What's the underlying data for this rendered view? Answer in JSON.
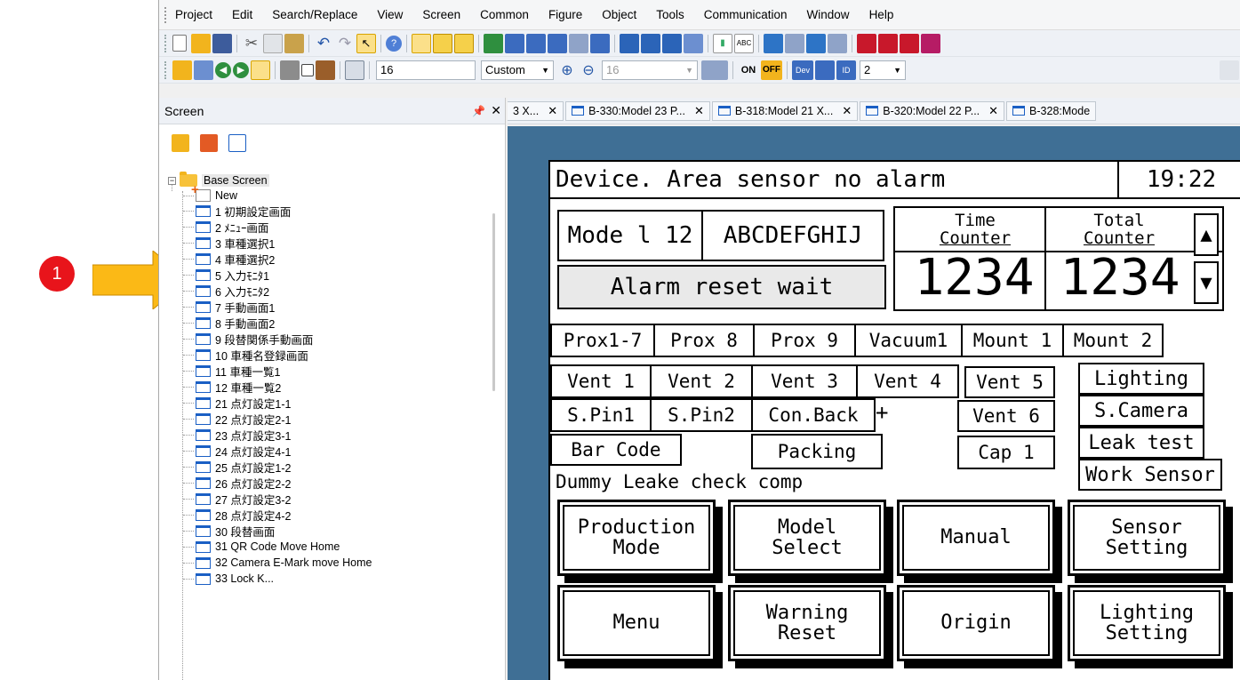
{
  "annotation": {
    "badge": "1"
  },
  "menubar": {
    "items": [
      "Project",
      "Edit",
      "Search/Replace",
      "View",
      "Screen",
      "Common",
      "Figure",
      "Object",
      "Tools",
      "Communication",
      "Window",
      "Help"
    ]
  },
  "toolbar3": {
    "font_size": "16",
    "custom": "Custom",
    "zoom": "16",
    "on": "ON",
    "off": "OFF",
    "dev": "Dev",
    "id": "ID",
    "layer": "2"
  },
  "screen_panel": {
    "title": "Screen",
    "pin": "⬜",
    "close": "✕",
    "root": "Base Screen",
    "new_item": "New",
    "items": [
      "1 初期設定画面",
      "2 ﾒﾆｭｰ画面",
      "3 車種選択1",
      "4 車種選択2",
      "5 入力ﾓﾆﾀ1",
      "6 入力ﾓﾆﾀ2",
      "7 手動画面1",
      "8 手動画面2",
      "9 段替関係手動画面",
      "10 車種名登録画面",
      "11 車種一覧1",
      "12 車種一覧2",
      "21 点灯設定1-1",
      "22 点灯設定2-1",
      "23 点灯設定3-1",
      "24 点灯設定4-1",
      "25 点灯設定1-2",
      "26 点灯設定2-2",
      "27 点灯設定3-2",
      "28 点灯設定4-2",
      "30 段替画面",
      "31 QR Code Move Home",
      "32 Camera E-Mark move Home",
      "33 Lock K..."
    ]
  },
  "tabs": [
    {
      "label": "3 X..."
    },
    {
      "label": "B-330:Model 23 P..."
    },
    {
      "label": "B-318:Model 21 X..."
    },
    {
      "label": "B-320:Model 22 P..."
    },
    {
      "label": "B-328:Mode"
    }
  ],
  "hmi": {
    "status": "Device. Area sensor no alarm",
    "time": "19:22",
    "model": "Mode l 12",
    "model_name": "ABCDEFGHIJ",
    "alarm_reset": "Alarm reset wait",
    "time_counter_label": [
      "Time",
      "Counter"
    ],
    "total_counter_label": [
      "Total",
      "Counter"
    ],
    "time_counter_value": "1234",
    "total_counter_value": "1234",
    "row1": [
      "Prox1-7",
      "Prox 8",
      "Prox 9",
      "Vacuum1",
      "Mount 1",
      "Mount 2"
    ],
    "row2": [
      "Vent 1",
      "Vent 2",
      "Vent 3",
      "Vent 4",
      "Vent 5",
      "Lighting"
    ],
    "row3": [
      "S.Pin1",
      "S.Pin2",
      "Con.Back",
      "Vent 6",
      "S.Camera"
    ],
    "row4": [
      "Bar Code",
      "Packing",
      "Cap 1",
      "Leak test"
    ],
    "work_sensor": "Work Sensor",
    "dummy": "Dummy Leake check comp",
    "buttons": [
      [
        "Production",
        "Mode"
      ],
      [
        "Model",
        "Select"
      ],
      [
        "Manual"
      ],
      [
        "Sensor",
        "Setting"
      ],
      [
        "Menu"
      ],
      [
        "Warning",
        "Reset"
      ],
      [
        "Origin"
      ],
      [
        "Lighting",
        "Setting"
      ]
    ]
  },
  "colors": {
    "canvas_bg": "#3f6f95",
    "badge": "#e8141b",
    "arrow": "#fbb916"
  }
}
